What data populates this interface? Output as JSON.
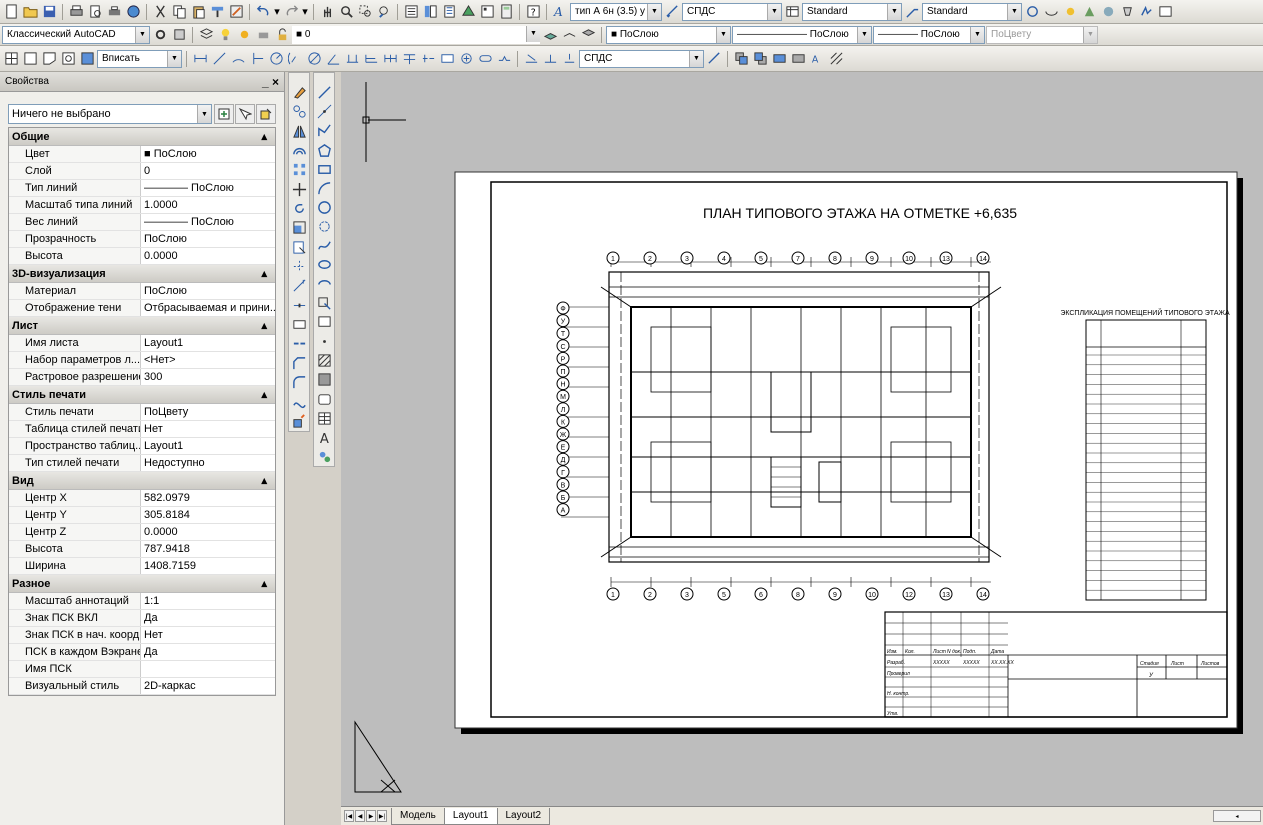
{
  "toolbar1": {
    "text_style": "тип А 6н (3.5) у",
    "dim_style": "СПДС",
    "table_style": "Standard",
    "mleader_style": "Standard"
  },
  "toolbar2": {
    "workspace": "Классический AutoCAD",
    "layer": "0",
    "color": "ПоСлою",
    "linetype": "ПоСлою",
    "lineweight": "ПоСлою",
    "plotstyle": "ПоЦвету"
  },
  "toolbar3": {
    "viewport_scale": "Вписать",
    "dim_style2": "СПДС"
  },
  "properties": {
    "title": "Свойства",
    "close": "_ ×",
    "selection": "Ничего не выбрано",
    "categories": [
      {
        "name": "Общие",
        "rows": [
          {
            "k": "Цвет",
            "v": "■ ПоСлою"
          },
          {
            "k": "Слой",
            "v": "0"
          },
          {
            "k": "Тип линий",
            "v": "———— ПоСлою"
          },
          {
            "k": "Масштаб типа линий",
            "v": "1.0000"
          },
          {
            "k": "Вес линий",
            "v": "———— ПоСлою"
          },
          {
            "k": "Прозрачность",
            "v": "ПоСлою"
          },
          {
            "k": "Высота",
            "v": "0.0000"
          }
        ]
      },
      {
        "name": "3D-визуализация",
        "rows": [
          {
            "k": "Материал",
            "v": "ПоСлою"
          },
          {
            "k": "Отображение тени",
            "v": "Отбрасываемая и прини..."
          }
        ]
      },
      {
        "name": "Лист",
        "rows": [
          {
            "k": "Имя листа",
            "v": "Layout1"
          },
          {
            "k": "Набор параметров л...",
            "v": "<Нет>"
          },
          {
            "k": "Растровое разрешение",
            "v": "300"
          }
        ]
      },
      {
        "name": "Стиль печати",
        "rows": [
          {
            "k": "Стиль печати",
            "v": "ПоЦвету"
          },
          {
            "k": "Таблица стилей печати",
            "v": "Нет"
          },
          {
            "k": "Пространство таблиц...",
            "v": "Layout1"
          },
          {
            "k": "Тип стилей печати",
            "v": "Недоступно"
          }
        ]
      },
      {
        "name": "Вид",
        "rows": [
          {
            "k": "Центр X",
            "v": "582.0979"
          },
          {
            "k": "Центр Y",
            "v": "305.8184"
          },
          {
            "k": "Центр Z",
            "v": "0.0000"
          },
          {
            "k": "Высота",
            "v": "787.9418"
          },
          {
            "k": "Ширина",
            "v": "1408.7159"
          }
        ]
      },
      {
        "name": "Разное",
        "rows": [
          {
            "k": "Масштаб аннотаций",
            "v": "1:1"
          },
          {
            "k": "Знак ПСК ВКЛ",
            "v": "Да"
          },
          {
            "k": "Знак ПСК в нач. коорд.",
            "v": "Нет"
          },
          {
            "k": "ПСК в каждом Вэкране",
            "v": "Да"
          },
          {
            "k": "Имя ПСК",
            "v": ""
          },
          {
            "k": "Визуальный стиль",
            "v": "2D-каркас"
          }
        ]
      }
    ]
  },
  "drawing": {
    "title": "ПЛАН ТИПОВОГО ЭТАЖА НА ОТМЕТКЕ +6,635",
    "legend_title": "ЭКСПЛИКАЦИЯ ПОМЕЩЕНИЙ ТИПОВОГО ЭТАЖА",
    "axes_top": [
      "1",
      "2",
      "3",
      "4",
      "5",
      "7",
      "8",
      "9",
      "10",
      "13",
      "14"
    ],
    "axes_bottom": [
      "1",
      "2",
      "3",
      "5",
      "6",
      "8",
      "9",
      "10",
      "12",
      "13",
      "14"
    ],
    "axes_left": [
      "Ф",
      "У",
      "Т",
      "С",
      "Р",
      "П",
      "Н",
      "М",
      "Л",
      "К",
      "Ж",
      "Е",
      "Д",
      "Г",
      "В",
      "Б",
      "А"
    ],
    "stamp": {
      "izm": "Изм.",
      "kol": "Кол.",
      "list": "Лист",
      "ndok": "N док.",
      "podp": "Подп.",
      "data": "Дата",
      "razrab": "Разраб.",
      "prover": "Проверил",
      "nkontr": "Н. контр.",
      "utv": "Утв.",
      "xx1": "ХХХХХ",
      "xx2": "ХХХХХ",
      "date": "ХХ.ХХ.ХХ",
      "stadia": "Стадия",
      "listh": "Лист",
      "listov": "Листов",
      "stage": "У"
    }
  },
  "tabs": {
    "model": "Модель",
    "layout1": "Layout1",
    "layout2": "Layout2"
  }
}
